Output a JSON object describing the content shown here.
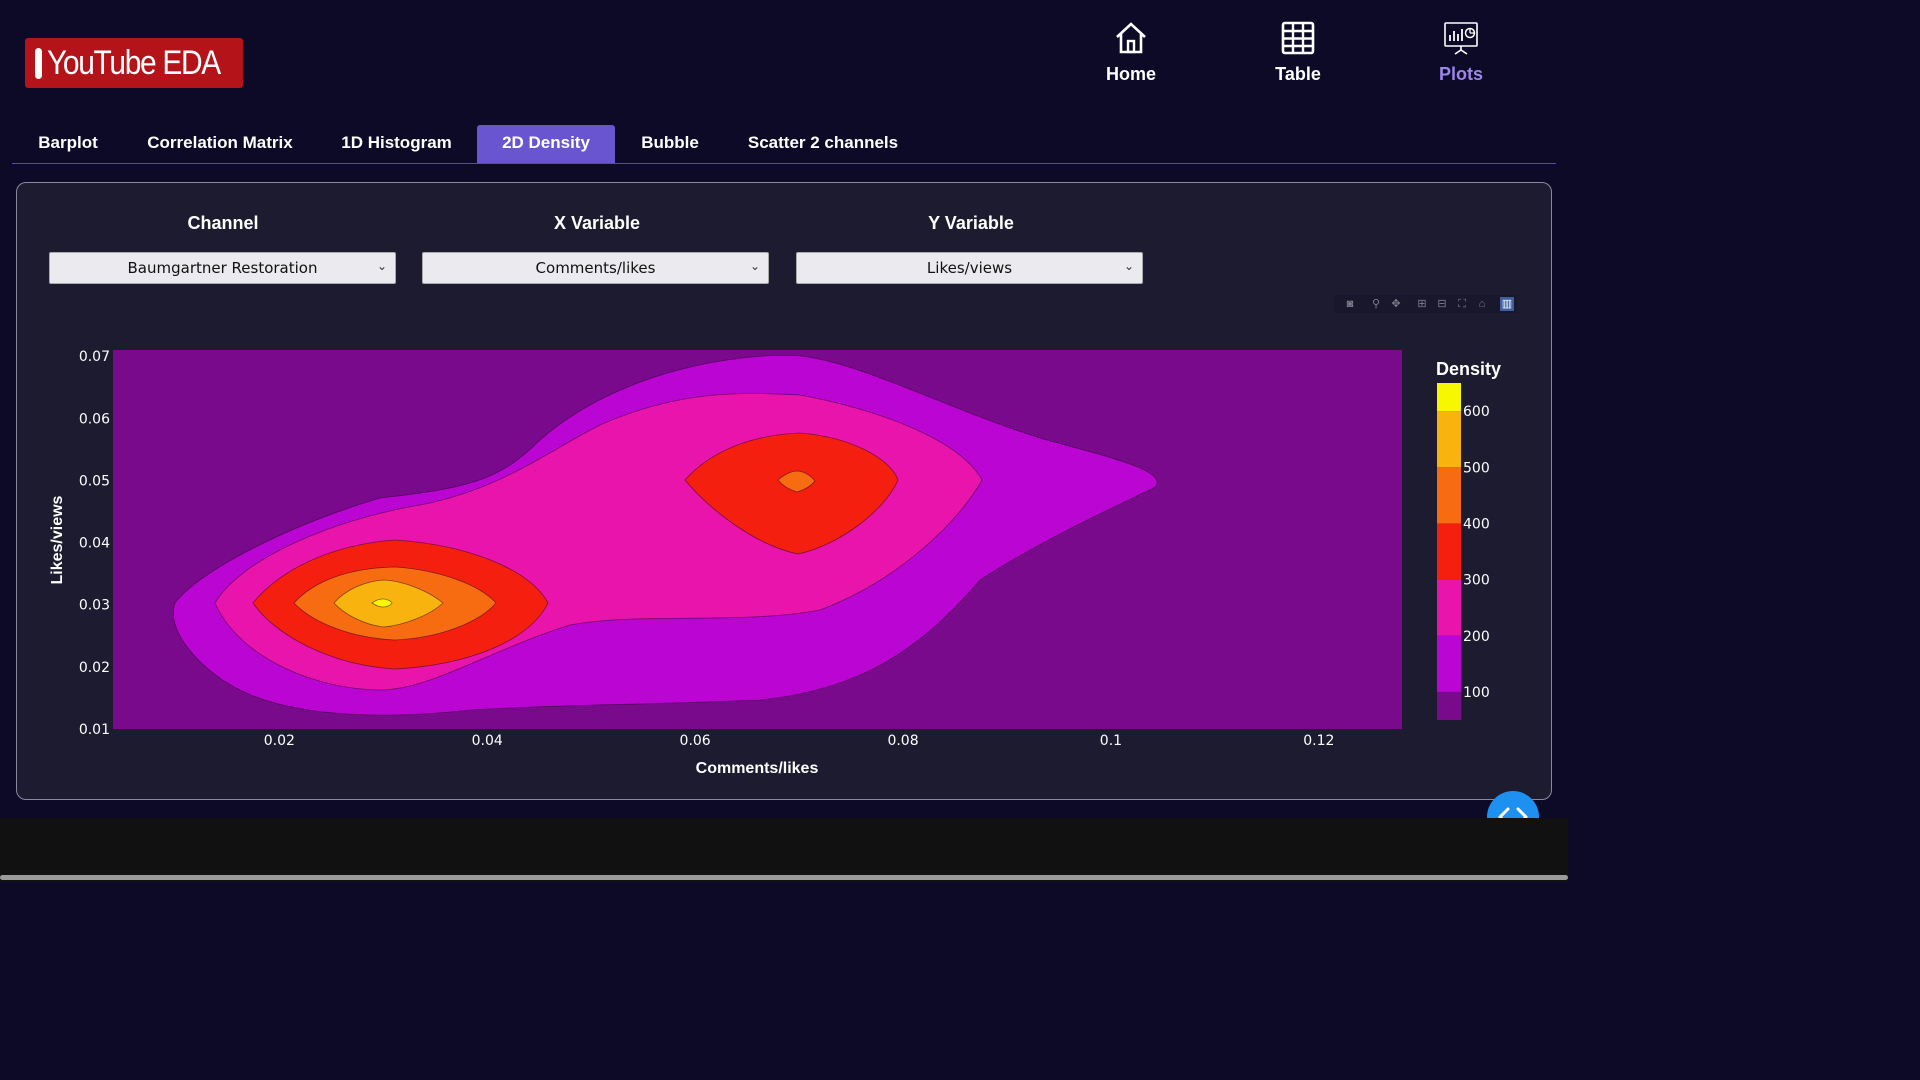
{
  "brand": {
    "logo_text": "YouTube EDA"
  },
  "nav": [
    {
      "label": "Home",
      "icon": "home-icon",
      "color": "#ffffff"
    },
    {
      "label": "Table",
      "icon": "table-icon",
      "color": "#ffffff"
    },
    {
      "label": "Plots",
      "icon": "presentation-chart-icon",
      "color": "#9b86ea"
    }
  ],
  "tabs": [
    {
      "label": "Barplot",
      "active": false
    },
    {
      "label": "Correlation Matrix",
      "active": false
    },
    {
      "label": "1D Histogram",
      "active": false
    },
    {
      "label": "2D Density",
      "active": true
    },
    {
      "label": "Bubble",
      "active": false
    },
    {
      "label": "Scatter 2 channels",
      "active": false
    }
  ],
  "controls": {
    "channel": {
      "label": "Channel",
      "value": "Baumgartner Restoration"
    },
    "x_variable": {
      "label": "X Variable",
      "value": "Comments/likes"
    },
    "y_variable": {
      "label": "Y Variable",
      "value": "Likes/views"
    }
  },
  "modebar": [
    "camera-icon",
    "zoom-icon",
    "pan-icon",
    "zoom-in-icon",
    "zoom-out-icon",
    "autoscale-icon",
    "reset-axes-icon",
    "plotly-logo-icon"
  ],
  "chart_data": {
    "type": "contour",
    "xlabel": "Comments/likes",
    "ylabel": "Likes/views",
    "xlim": [
      0.004,
      0.128
    ],
    "ylim": [
      0.01,
      0.071
    ],
    "x_ticks": [
      "0.02",
      "0.04",
      "0.06",
      "0.08",
      "0.1",
      "0.12"
    ],
    "y_ticks": [
      "0.01",
      "0.02",
      "0.03",
      "0.04",
      "0.05",
      "0.06",
      "0.07"
    ],
    "colorbar": {
      "title": "Density",
      "ticks": [
        "100",
        "200",
        "300",
        "400",
        "500",
        "600"
      ],
      "range": [
        50,
        650
      ],
      "levels": [
        {
          "from": 50,
          "to": 100,
          "color": "#7a0a8c"
        },
        {
          "from": 100,
          "to": 200,
          "color": "#bb05d2"
        },
        {
          "from": 200,
          "to": 300,
          "color": "#e814ab"
        },
        {
          "from": 300,
          "to": 400,
          "color": "#f51f0f"
        },
        {
          "from": 400,
          "to": 500,
          "color": "#f76c11"
        },
        {
          "from": 500,
          "to": 600,
          "color": "#f8b30e"
        },
        {
          "from": 600,
          "to": 650,
          "color": "#f6f700"
        }
      ]
    },
    "peaks": [
      {
        "x": 0.03,
        "y": 0.03,
        "density": 620
      },
      {
        "x": 0.07,
        "y": 0.05,
        "density": 450
      }
    ]
  },
  "colors": {
    "background": "#0c0a26",
    "panel": "#1d1b30",
    "active_tab": "#6a55d0",
    "fab": "#1e90f0"
  }
}
